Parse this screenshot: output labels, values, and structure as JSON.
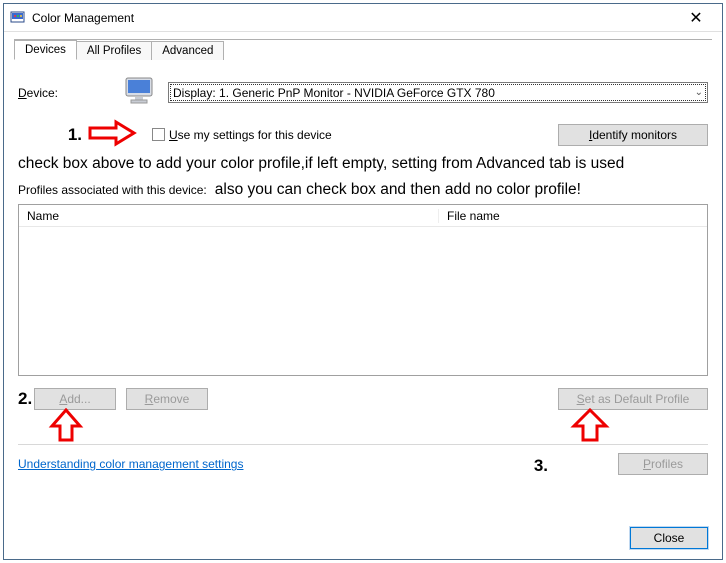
{
  "window": {
    "title": "Color Management"
  },
  "tabs": [
    {
      "label": "Devices"
    },
    {
      "label": "All Profiles"
    },
    {
      "label": "Advanced"
    }
  ],
  "device": {
    "label_prefix": "D",
    "label_rest": "evice:",
    "selected": "Display: 1. Generic PnP Monitor - NVIDIA GeForce GTX 780"
  },
  "use_settings": {
    "label_prefix": "U",
    "label_rest": "se my settings for this device"
  },
  "identify_btn": {
    "prefix": "I",
    "rest": "dentify monitors"
  },
  "annotations": {
    "step1": "1.",
    "line1": "check box above to add your color profile,if left empty, setting from Advanced tab is used",
    "profiles_assoc": "Profiles associated with this device:",
    "line2": "also you can check box and then add no color profile!",
    "step2": "2.",
    "step3": "3."
  },
  "listview": {
    "col_name": "Name",
    "col_file": "File name"
  },
  "buttons": {
    "add_prefix": "A",
    "add_rest": "dd...",
    "remove_prefix": "R",
    "remove_rest": "emove",
    "setdefault_prefix": "S",
    "setdefault_rest": "et as Default Profile",
    "profiles_prefix": "P",
    "profiles_rest": "rofiles",
    "close": "Close"
  },
  "link": "Understanding color management settings"
}
